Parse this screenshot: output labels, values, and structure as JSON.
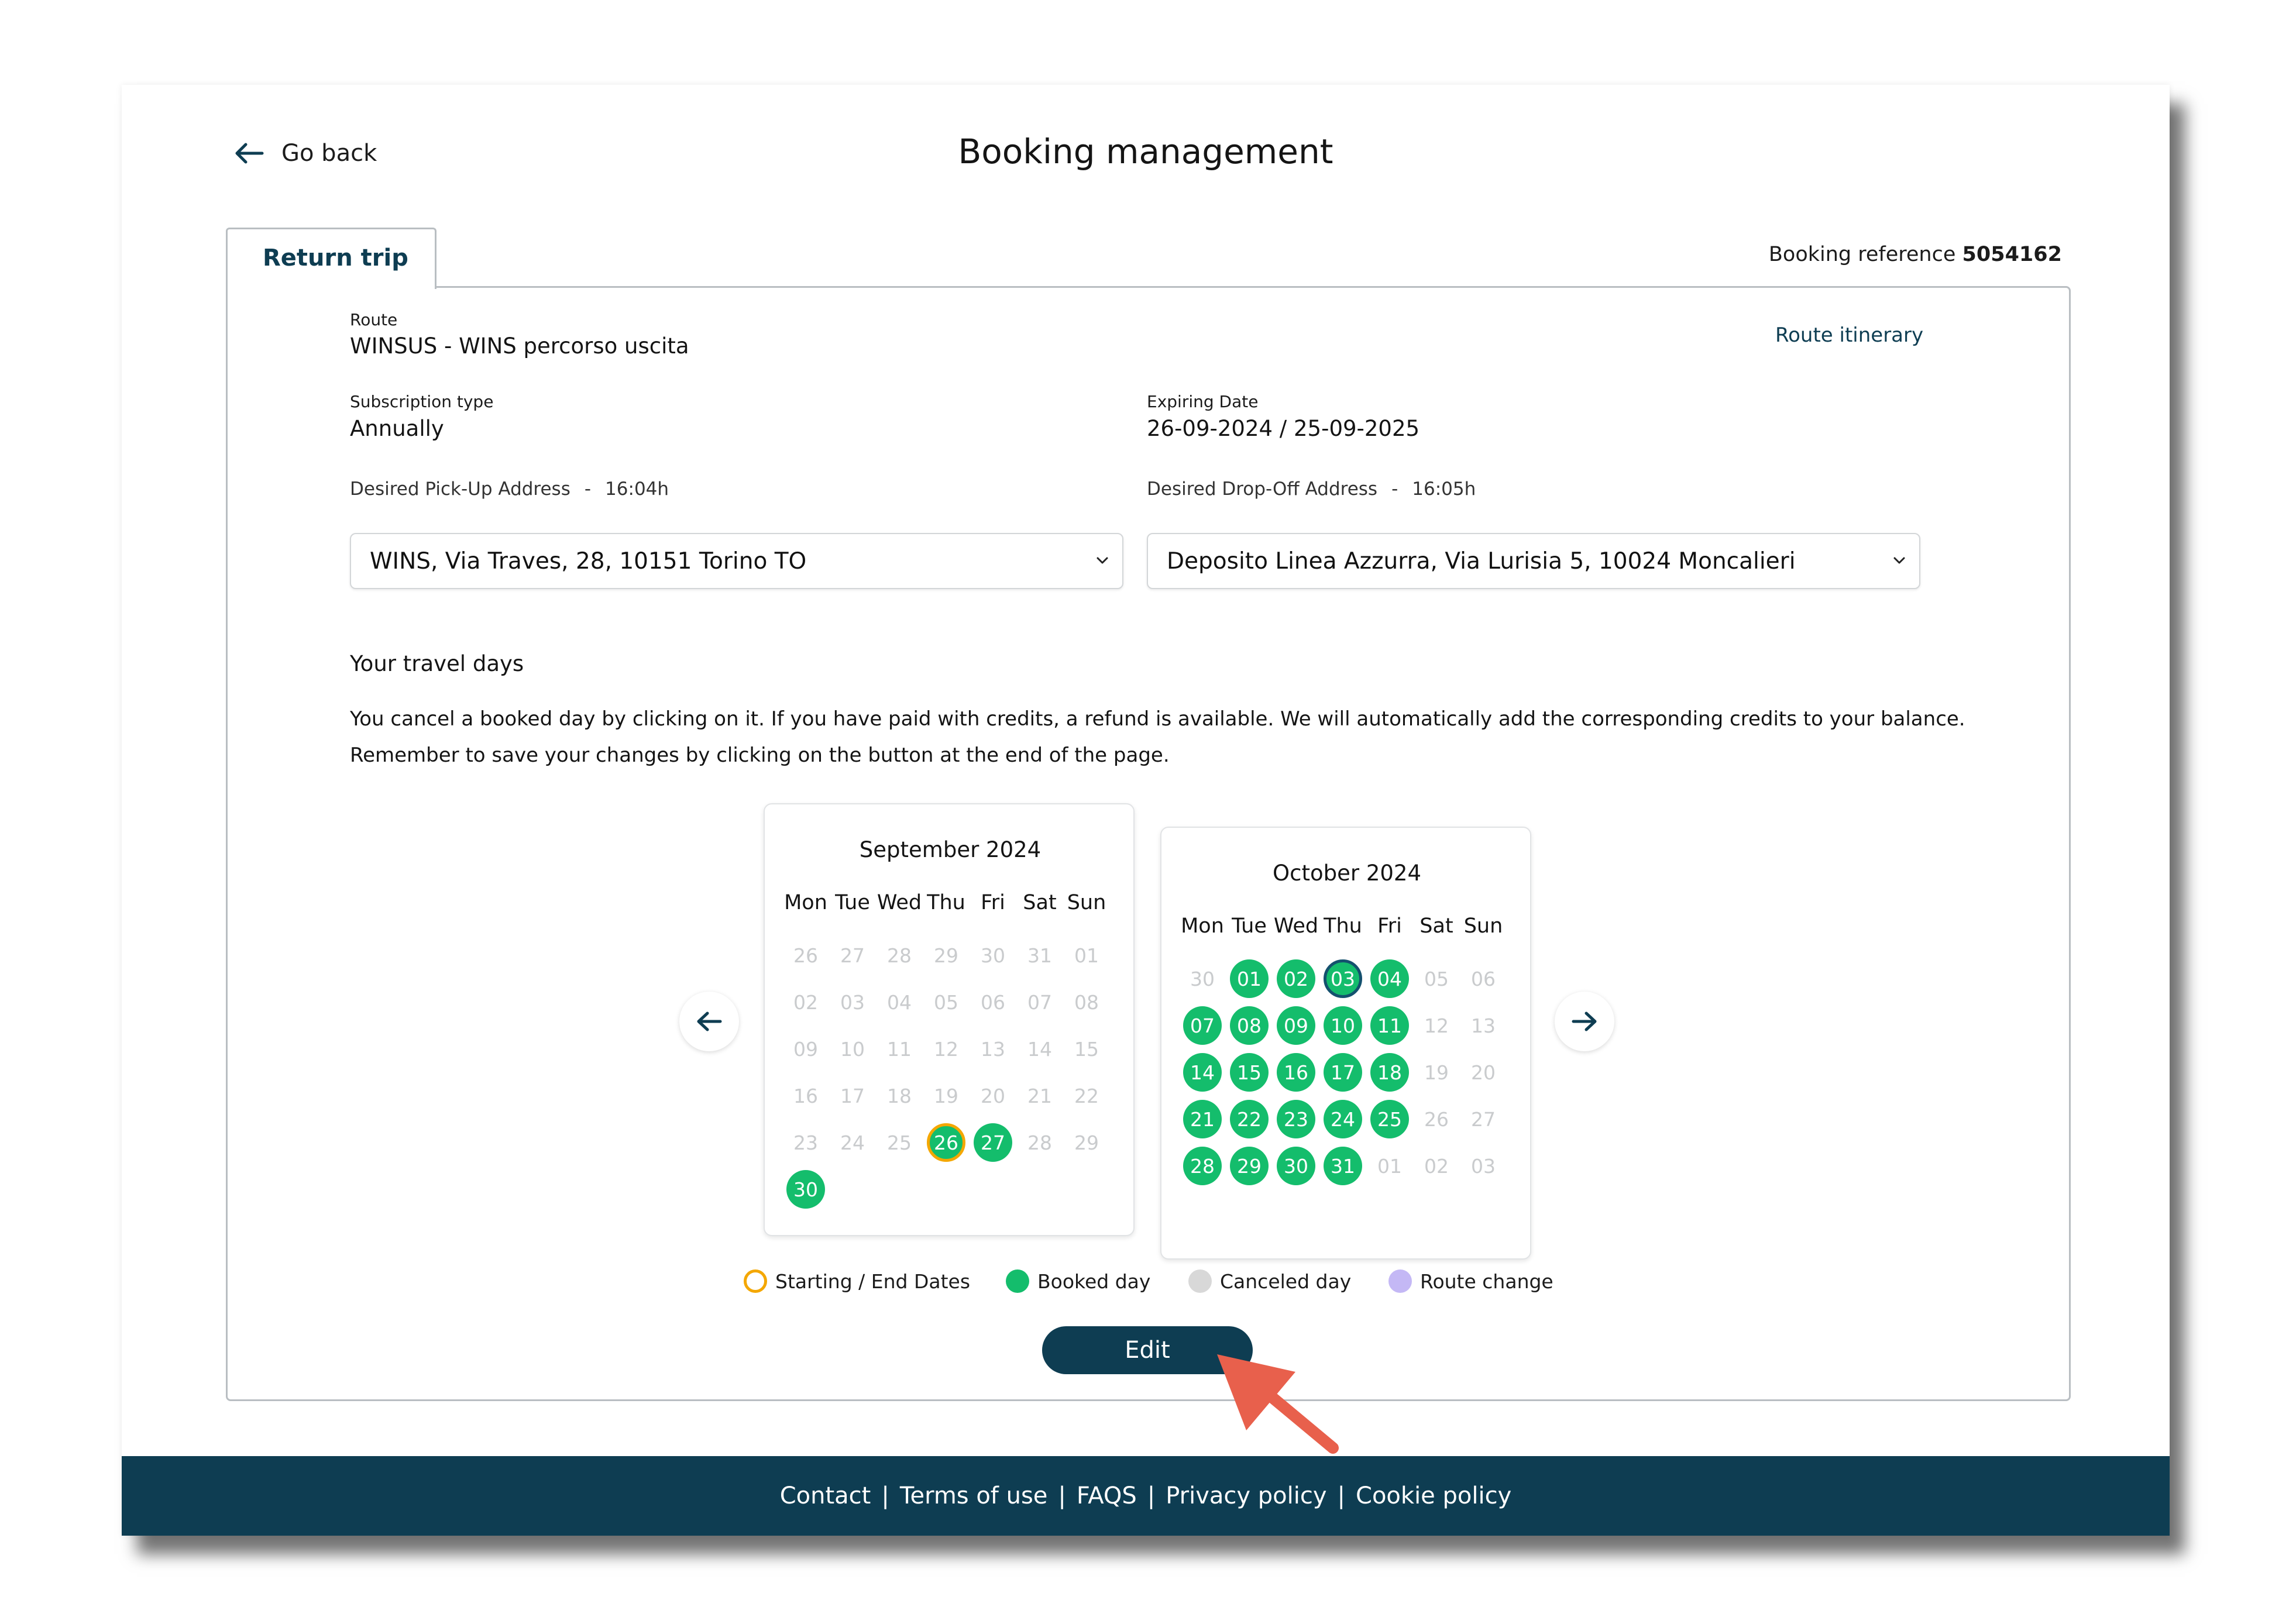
{
  "header": {
    "back_label": "Go back",
    "title": "Booking management"
  },
  "tab": {
    "label": "Return trip"
  },
  "booking": {
    "reference_label": "Booking reference",
    "reference_value": "5054162"
  },
  "route": {
    "label": "Route",
    "value": "WINSUS - WINS percorso uscita",
    "itinerary_link": "Route itinerary"
  },
  "subscription": {
    "label": "Subscription type",
    "value": "Annually"
  },
  "expiring": {
    "label": "Expiring Date",
    "value": "26-09-2024 / 25-09-2025"
  },
  "pickup": {
    "label": "Desired Pick-Up Address",
    "sep": "-",
    "time": "16:04h",
    "selected": "WINS, Via Traves, 28, 10151 Torino TO"
  },
  "dropoff": {
    "label": "Desired Drop-Off Address",
    "sep": "-",
    "time": "16:05h",
    "selected": "Deposito Linea Azzurra, Via Lurisia 5, 10024 Moncalieri"
  },
  "travel": {
    "heading": "Your travel days",
    "info": "You cancel a booked day by clicking on it. If you have paid with credits, a refund is available. We will automatically add the corresponding credits to your balance. Remember to save your changes by clicking on the button at the end of the page."
  },
  "weekdays": [
    "Mon",
    "Tue",
    "Wed",
    "Thu",
    "Fri",
    "Sat",
    "Sun"
  ],
  "calendars": [
    {
      "title": "September 2024",
      "weeks": [
        [
          [
            "26",
            "muted"
          ],
          [
            "27",
            "muted"
          ],
          [
            "28",
            "muted"
          ],
          [
            "29",
            "muted"
          ],
          [
            "30",
            "muted"
          ],
          [
            "31",
            "muted"
          ],
          [
            "01",
            "muted"
          ]
        ],
        [
          [
            "02",
            "muted"
          ],
          [
            "03",
            "muted"
          ],
          [
            "04",
            "muted"
          ],
          [
            "05",
            "muted"
          ],
          [
            "06",
            "muted"
          ],
          [
            "07",
            "muted"
          ],
          [
            "08",
            "muted"
          ]
        ],
        [
          [
            "09",
            "muted"
          ],
          [
            "10",
            "muted"
          ],
          [
            "11",
            "muted"
          ],
          [
            "12",
            "muted"
          ],
          [
            "13",
            "muted"
          ],
          [
            "14",
            "muted"
          ],
          [
            "15",
            "muted"
          ]
        ],
        [
          [
            "16",
            "muted"
          ],
          [
            "17",
            "muted"
          ],
          [
            "18",
            "muted"
          ],
          [
            "19",
            "muted"
          ],
          [
            "20",
            "muted"
          ],
          [
            "21",
            "muted"
          ],
          [
            "22",
            "muted"
          ]
        ],
        [
          [
            "23",
            "muted"
          ],
          [
            "24",
            "muted"
          ],
          [
            "25",
            "muted"
          ],
          [
            "26",
            "booked start"
          ],
          [
            "27",
            "booked"
          ],
          [
            "28",
            "muted"
          ],
          [
            "29",
            "muted"
          ]
        ],
        [
          [
            "30",
            "booked"
          ]
        ]
      ]
    },
    {
      "title": "October 2024",
      "weeks": [
        [
          [
            "30",
            "muted"
          ],
          [
            "01",
            "booked"
          ],
          [
            "02",
            "booked"
          ],
          [
            "03",
            "booked today"
          ],
          [
            "04",
            "booked"
          ],
          [
            "05",
            "muted"
          ],
          [
            "06",
            "muted"
          ]
        ],
        [
          [
            "07",
            "booked"
          ],
          [
            "08",
            "booked"
          ],
          [
            "09",
            "booked"
          ],
          [
            "10",
            "booked"
          ],
          [
            "11",
            "booked"
          ],
          [
            "12",
            "muted"
          ],
          [
            "13",
            "muted"
          ]
        ],
        [
          [
            "14",
            "booked"
          ],
          [
            "15",
            "booked"
          ],
          [
            "16",
            "booked"
          ],
          [
            "17",
            "booked"
          ],
          [
            "18",
            "booked"
          ],
          [
            "19",
            "muted"
          ],
          [
            "20",
            "muted"
          ]
        ],
        [
          [
            "21",
            "booked"
          ],
          [
            "22",
            "booked"
          ],
          [
            "23",
            "booked"
          ],
          [
            "24",
            "booked"
          ],
          [
            "25",
            "booked"
          ],
          [
            "26",
            "muted"
          ],
          [
            "27",
            "muted"
          ]
        ],
        [
          [
            "28",
            "booked"
          ],
          [
            "29",
            "booked"
          ],
          [
            "30",
            "booked"
          ],
          [
            "31",
            "booked"
          ],
          [
            "01",
            "muted"
          ],
          [
            "02",
            "muted"
          ],
          [
            "03",
            "muted"
          ]
        ]
      ]
    }
  ],
  "legend": {
    "start_end": "Starting / End Dates",
    "booked": "Booked day",
    "canceled": "Canceled day",
    "route_change": "Route change"
  },
  "actions": {
    "edit_label": "Edit"
  },
  "footer": {
    "contact": "Contact",
    "terms": "Terms of use",
    "faqs": "FAQS",
    "privacy": "Privacy policy",
    "cookie": "Cookie policy",
    "separator": "|"
  },
  "colors": {
    "brand_dark": "#0e3d52",
    "booked": "#14bd6c",
    "start_end": "#f4a700",
    "canceled": "#d8d8d8",
    "route_change": "#c4b8f5",
    "annotation_arrow": "#e8604c"
  },
  "icons": {
    "back": "arrow-left-icon",
    "prev": "arrow-left-icon",
    "next": "arrow-right-icon",
    "select": "chevron-down-icon"
  }
}
